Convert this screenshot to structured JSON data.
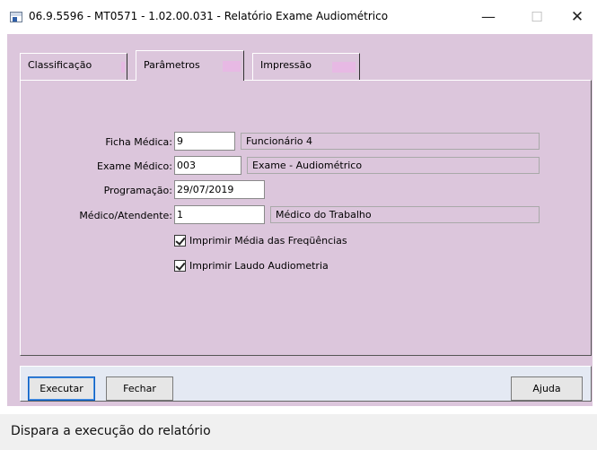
{
  "window": {
    "title": "06.9.5596 - MT0571 - 1.02.00.031 - Relatório Exame Audiométrico",
    "minimize": "—",
    "maximize": "☐",
    "close": "✕"
  },
  "tabs": [
    {
      "label": "Classificação"
    },
    {
      "label": "Parâmetros"
    },
    {
      "label": "Impressão"
    }
  ],
  "form": {
    "ficha_medica": {
      "label": "Ficha Médica:",
      "value": "9",
      "description": "Funcionário 4"
    },
    "exame_medico": {
      "label": "Exame Médico:",
      "value": "003",
      "description": "Exame - Audiométrico"
    },
    "programacao": {
      "label": "Programação:",
      "value": "29/07/2019"
    },
    "medico_atendente": {
      "label": "Médico/Atendente:",
      "value": "1",
      "description": "Médico do Trabalho"
    },
    "chk_media": {
      "label": "Imprimir Média das Freqüências",
      "checked": true
    },
    "chk_laudo": {
      "label": "Imprimir Laudo Audiometria",
      "checked": true
    }
  },
  "buttons": {
    "executar": "Executar",
    "fechar": "Fechar",
    "ajuda": "Ajuda"
  },
  "status": {
    "text": "Dispara a execução do relatório"
  }
}
